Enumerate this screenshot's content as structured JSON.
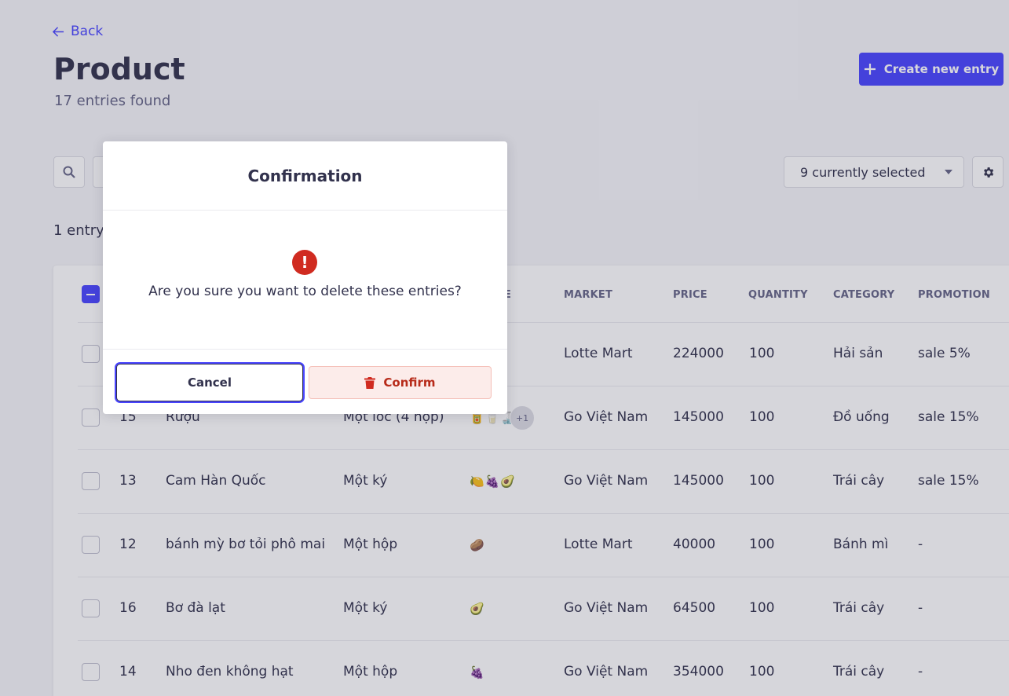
{
  "header": {
    "back_label": "Back",
    "title": "Product",
    "subtitle": "17 entries found",
    "create_label": "Create new entry"
  },
  "toolbar": {
    "columns_select_value": "9 currently selected"
  },
  "selection": {
    "count_text": "1 entry"
  },
  "table": {
    "headers": [
      "MARKET",
      "PRICE",
      "QUANTITY",
      "CATEGORY",
      "PROMOTION"
    ],
    "partial_header": "E",
    "rows": [
      {
        "id": "",
        "name": "",
        "unit": "",
        "images": [],
        "more": "",
        "market": "Lotte Mart",
        "price": "224000",
        "quantity": "100",
        "category": "Hải sản",
        "promotion": "sale 5%"
      },
      {
        "id": "15",
        "name": "Rượu",
        "unit": "Một lốc (4 hộp)",
        "images": [
          "🥫",
          "🥛",
          "🍶"
        ],
        "more": "+1",
        "market": "Go Việt Nam",
        "price": "145000",
        "quantity": "100",
        "category": "Đồ uống",
        "promotion": "sale 15%"
      },
      {
        "id": "13",
        "name": "Cam Hàn Quốc",
        "unit": "Một ký",
        "images": [
          "🍋",
          "🍇",
          "🥑"
        ],
        "more": "",
        "market": "Go Việt Nam",
        "price": "145000",
        "quantity": "100",
        "category": "Trái cây",
        "promotion": "sale 15%"
      },
      {
        "id": "12",
        "name": "bánh mỳ bơ tỏi phô mai",
        "unit": "Một hộp",
        "images": [
          "🥔"
        ],
        "more": "",
        "market": "Lotte Mart",
        "price": "40000",
        "quantity": "100",
        "category": "Bánh mì",
        "promotion": "-"
      },
      {
        "id": "16",
        "name": "Bơ đà lạt",
        "unit": "Một ký",
        "images": [
          "🥑"
        ],
        "more": "",
        "market": "Go Việt Nam",
        "price": "64500",
        "quantity": "100",
        "category": "Trái cây",
        "promotion": "-"
      },
      {
        "id": "14",
        "name": "Nho đen không hạt",
        "unit": "Một hộp",
        "images": [
          "🍇"
        ],
        "more": "",
        "market": "Go Việt Nam",
        "price": "354000",
        "quantity": "100",
        "category": "Trái cây",
        "promotion": "-"
      }
    ]
  },
  "modal": {
    "title": "Confirmation",
    "icon": "warning-icon",
    "icon_glyph": "!",
    "message": "Are you sure you want to delete these entries?",
    "cancel_label": "Cancel",
    "confirm_label": "Confirm"
  },
  "colors": {
    "primary": "#4945ff",
    "danger": "#d02b20",
    "danger_light": "#fcecea"
  }
}
